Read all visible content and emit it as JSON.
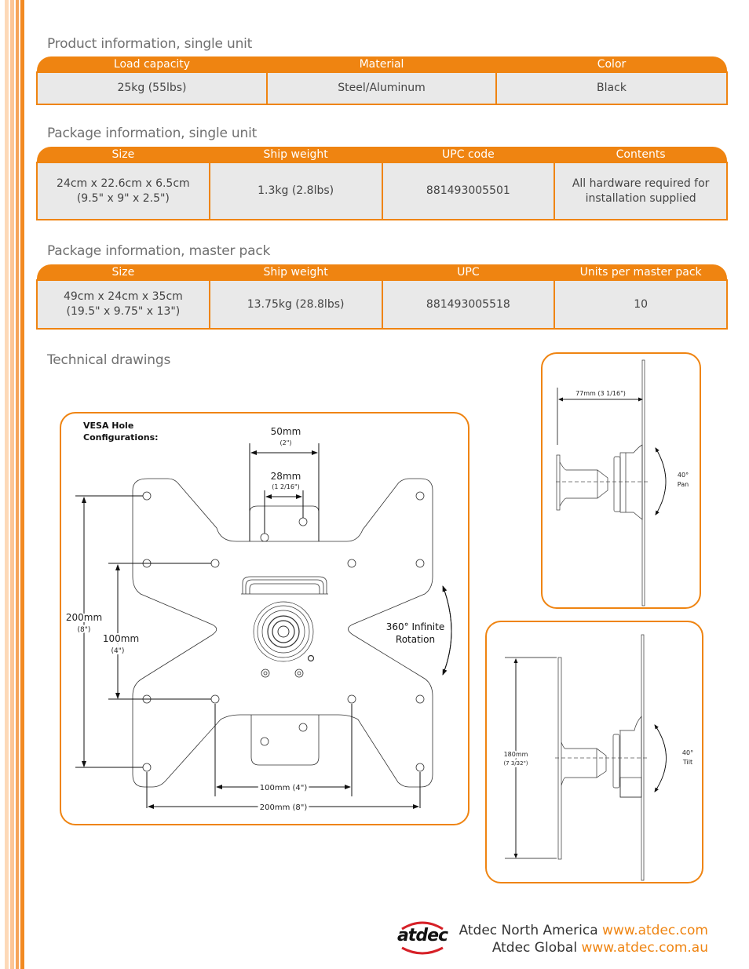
{
  "colors": {
    "accent": "#ef8411",
    "cell_background": "#e9e9e9",
    "stripes": [
      "#fdd9b8",
      "#fcc596",
      "#f6a45a",
      "#f28a22"
    ],
    "logo_red": "#d62027"
  },
  "product_info": {
    "title": "Product information, single unit",
    "headers": [
      "Load capacity",
      "Material",
      "Color"
    ],
    "rows": [
      [
        "25kg (55lbs)",
        "Steel/Aluminum",
        "Black"
      ]
    ]
  },
  "package_single": {
    "title": "Package information, single unit",
    "headers": [
      "Size",
      "Ship weight",
      "UPC code",
      "Contents"
    ],
    "rows": [
      [
        "24cm x 22.6cm x 6.5cm",
        "1.3kg (2.8lbs)",
        "881493005501",
        "All hardware required for"
      ]
    ],
    "rows_line2": [
      "(9.5\" x 9\" x 2.5\")",
      "",
      "",
      "installation supplied"
    ]
  },
  "package_master": {
    "title": "Package information, master pack",
    "headers": [
      "Size",
      "Ship weight",
      "UPC",
      "Units per master pack"
    ],
    "rows": [
      [
        "49cm x 24cm x 35cm",
        "13.75kg (28.8lbs)",
        "881493005518",
        "10"
      ]
    ],
    "rows_line2": [
      "(19.5\" x 9.75\" x 13\")",
      "",
      "",
      ""
    ]
  },
  "technical": {
    "title": "Technical drawings",
    "vesa": {
      "heading_line1": "VESA Hole",
      "heading_line2": "Configurations:",
      "dim_50": "50mm",
      "dim_50_in": "(2\")",
      "dim_28": "28mm",
      "dim_28_in": "(1 2/16\")",
      "dim_200_v": "200mm",
      "dim_200_v_in": "(8\")",
      "dim_100_v": "100mm",
      "dim_100_v_in": "(4\")",
      "dim_100_h": "100mm (4\")",
      "dim_200_h": "200mm (8\")",
      "rotation_line1": "360° Infinite",
      "rotation_line2": "Rotation"
    },
    "side_pan": {
      "depth": "77mm (3 1/16\")",
      "angle": "40°",
      "label": "Pan"
    },
    "side_tilt": {
      "height": "180mm",
      "height_in": "(7 3/32\")",
      "angle": "40°",
      "label": "Tilt"
    }
  },
  "footer": {
    "logo_text": "atdec",
    "lines": [
      {
        "label": "Atdec North America",
        "url": "www.atdec.com"
      },
      {
        "label": "Atdec Global",
        "url": "www.atdec.com.au"
      }
    ]
  }
}
